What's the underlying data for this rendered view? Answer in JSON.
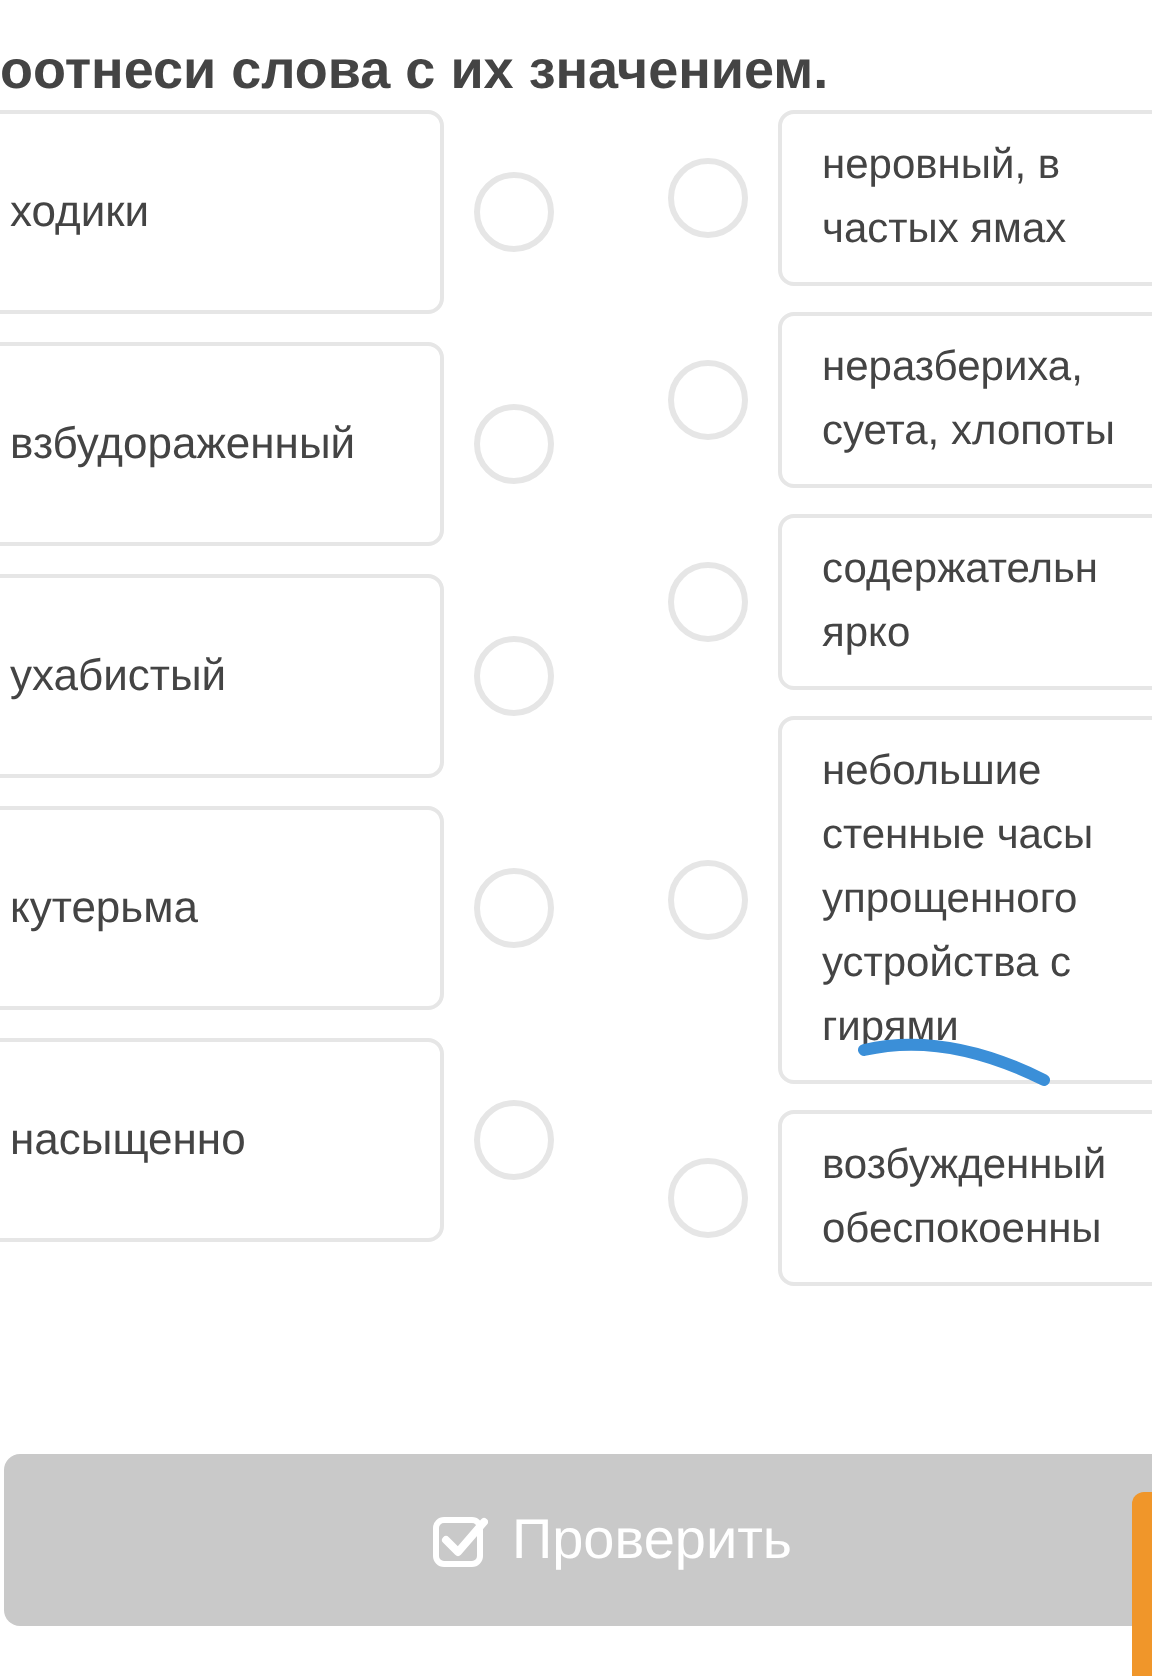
{
  "title": "оотнеси слова с их значением.",
  "words": [
    {
      "text": "ходики",
      "selected": false
    },
    {
      "text": "взбудораженный",
      "selected": false
    },
    {
      "text": "ухабистый",
      "selected": false
    },
    {
      "text": "кутерьма",
      "selected": false
    },
    {
      "text": "насыщенно",
      "selected": false
    }
  ],
  "meanings": [
    {
      "text": "неровный, в\nчастых ямах",
      "selected": false
    },
    {
      "text": "неразбериха,\nсуета, хлопоты",
      "selected": false
    },
    {
      "text": "содержательн\nярко",
      "selected": false
    },
    {
      "text": "небольшие\nстенные часы\nупрощенного\nустройства с\nгирями",
      "selected": false
    },
    {
      "text": "возбужденный\nобеспокоенны",
      "selected": false
    }
  ],
  "button": {
    "label": "Проверить",
    "disabled": true
  }
}
